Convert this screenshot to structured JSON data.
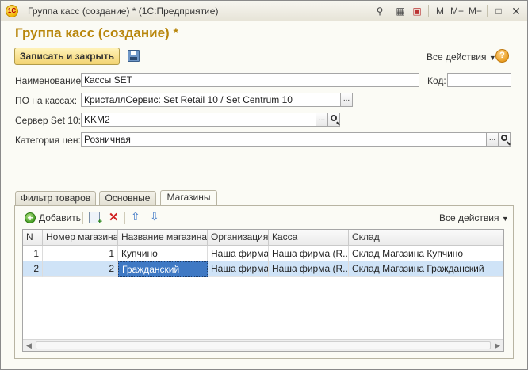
{
  "window": {
    "title": "Группа касс (создание) * (1С:Предприятие)",
    "logo_text": "1С",
    "toolbar": [
      "M",
      "M+",
      "M−"
    ]
  },
  "form": {
    "heading": "Группа касс (создание) *",
    "save_close_label": "Записать и закрыть",
    "all_actions_label": "Все действия",
    "help_label": "?"
  },
  "fields": {
    "name_label": "Наименование:",
    "name_value": "Кассы SET",
    "code_label": "Код:",
    "code_value": "",
    "po_label": "ПО на кассах:",
    "po_value": "КристаллСервис: Set Retail 10 / Set Centrum 10",
    "server_label": "Сервер Set 10:",
    "server_value": "KKM2",
    "price_label": "Категория цен:",
    "price_value": "Розничная",
    "ellipsis": "..."
  },
  "tabs": [
    {
      "label": "Фильтр товаров"
    },
    {
      "label": "Основные"
    },
    {
      "label": "Магазины"
    }
  ],
  "table_toolbar": {
    "add_label": "Добавить",
    "all_actions_label": "Все действия"
  },
  "table": {
    "columns": [
      "N",
      "Номер магазина",
      "Название магазина",
      "Организация",
      "Касса",
      "Склад"
    ],
    "rows": [
      [
        "1",
        "1",
        "Купчино",
        "Наша фирма",
        "Наша фирма (R...",
        "Склад Магазина Купчино"
      ],
      [
        "2",
        "2",
        "Гражданский",
        "Наша фирма",
        "Наша фирма (R...",
        "Склад Магазина Гражданский"
      ]
    ]
  }
}
